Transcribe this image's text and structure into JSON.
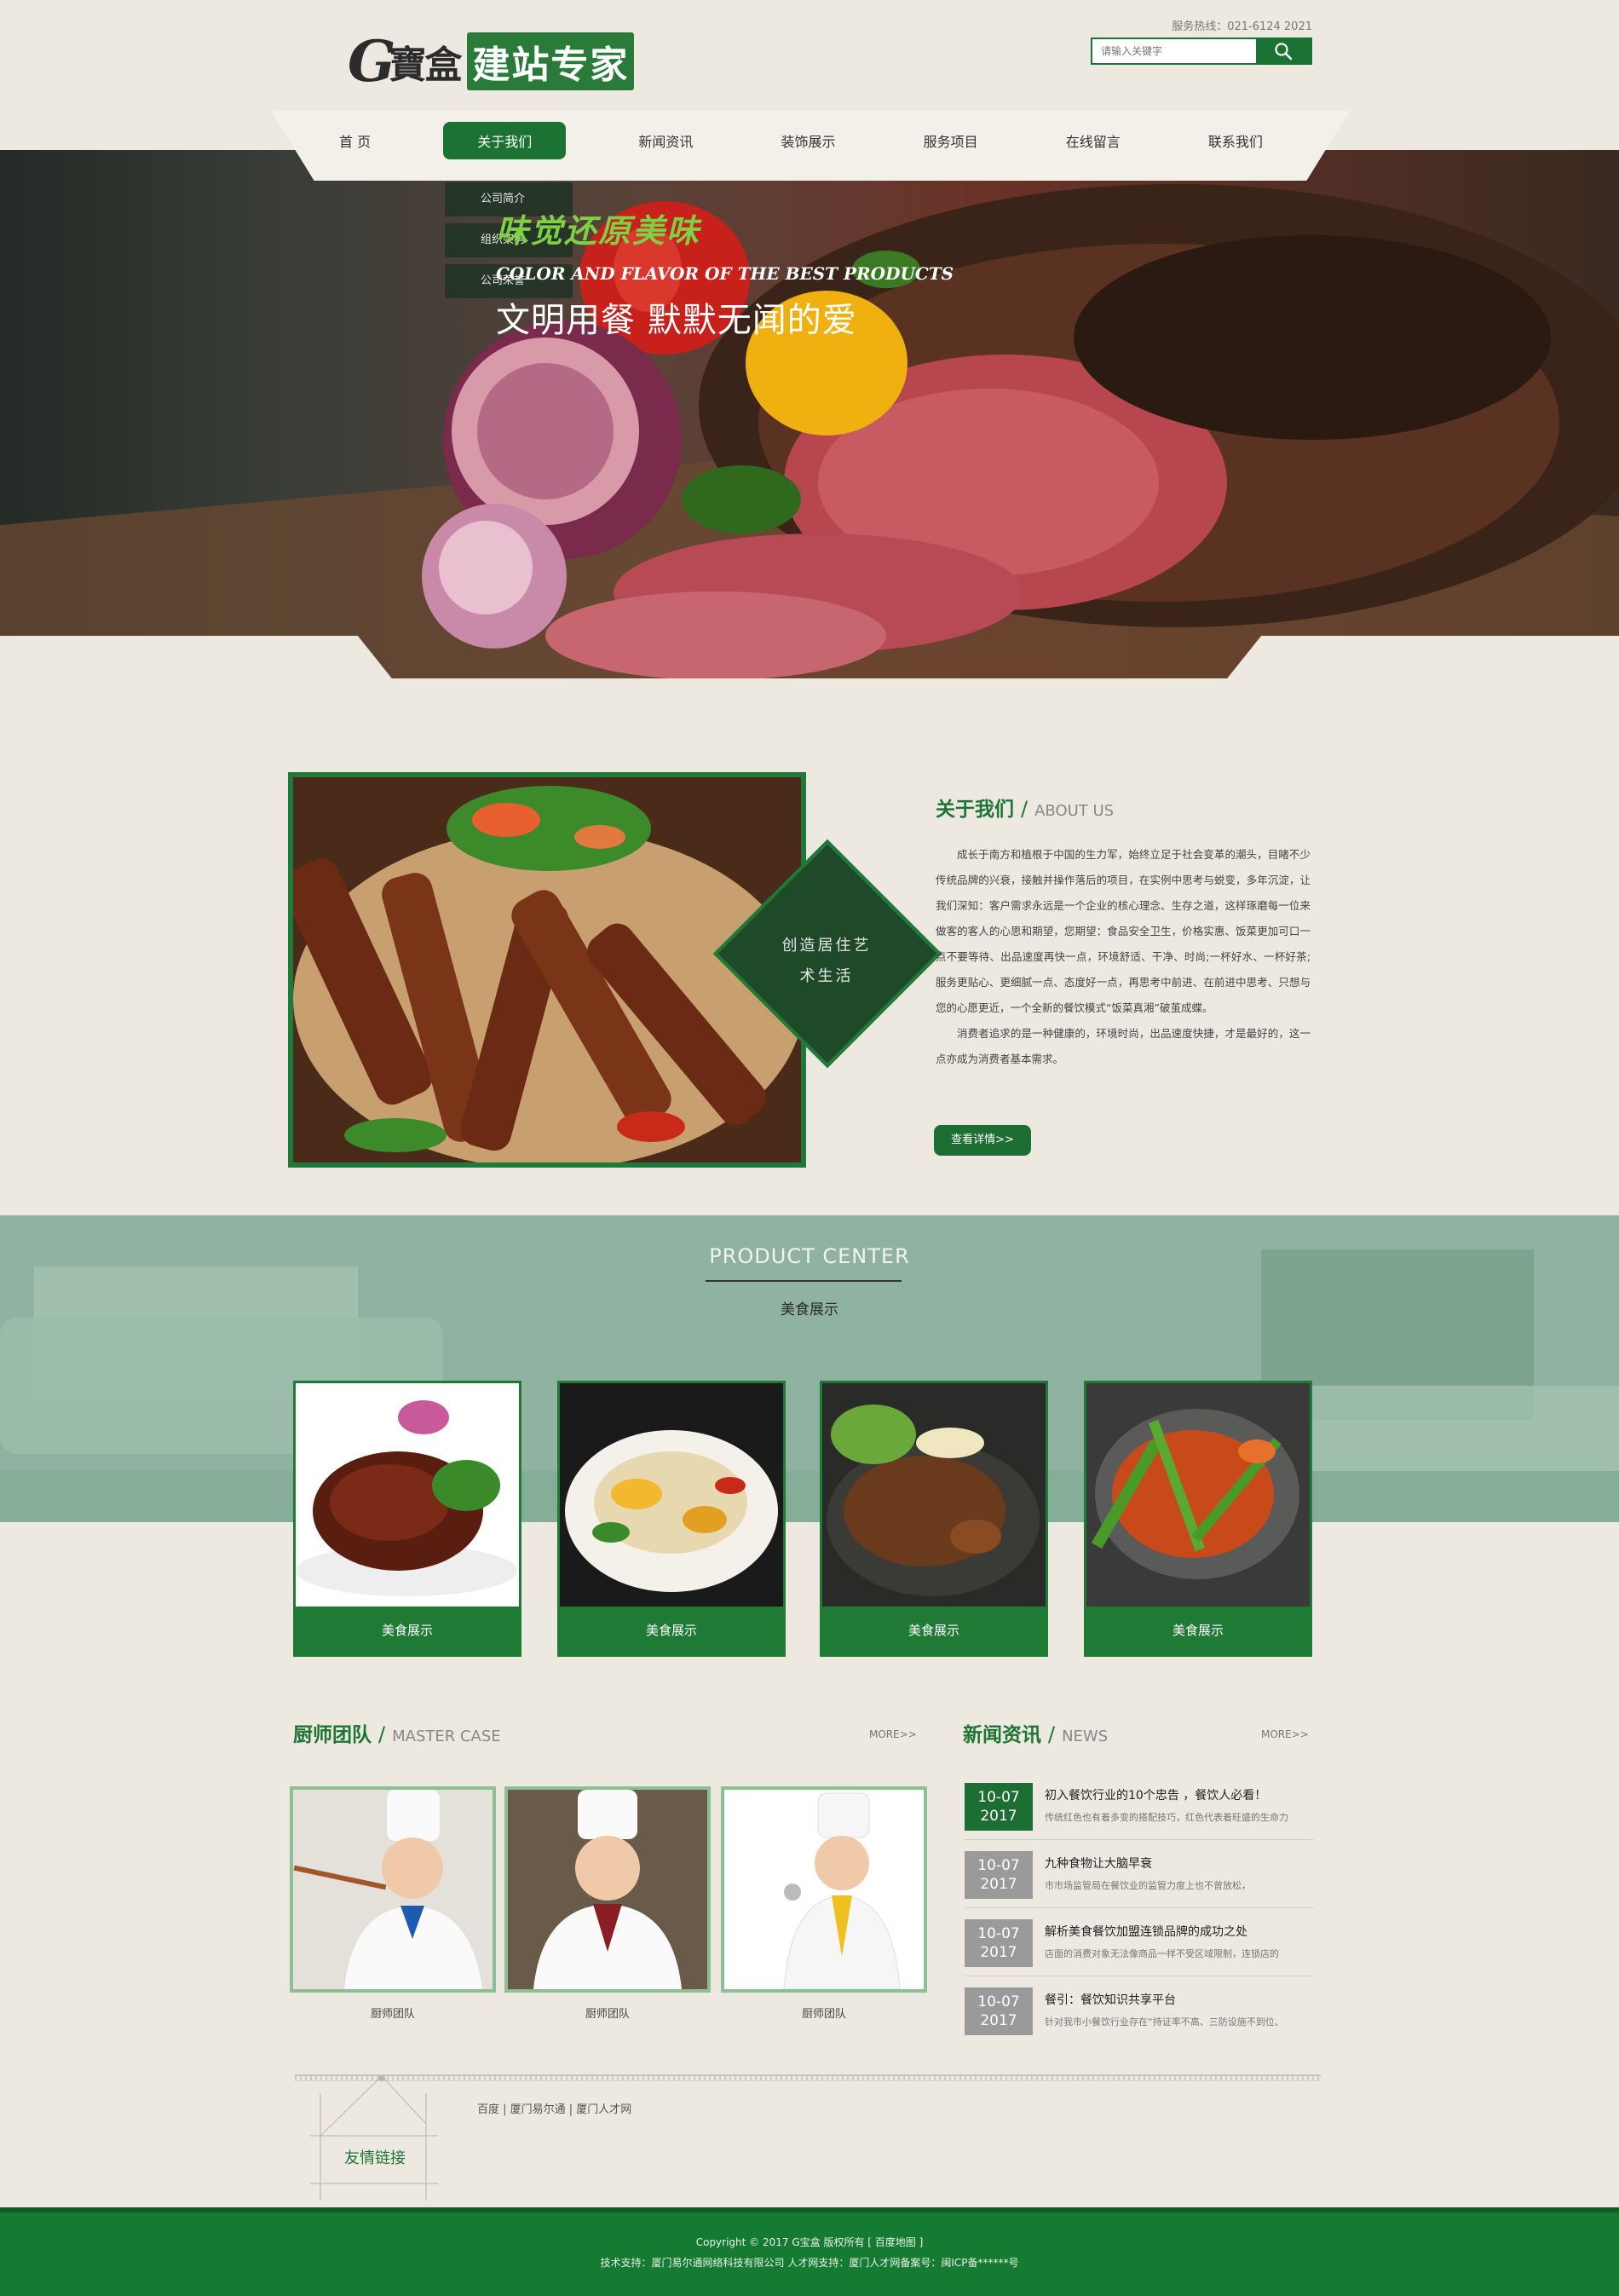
{
  "header": {
    "logo_g": "G",
    "logo_brand": "寶盒",
    "logo_tag": "建站专家",
    "hotline": "服务热线：021-6124 2021",
    "search_placeholder": "请输入关键字"
  },
  "nav": {
    "items": [
      "首 页",
      "关于我们",
      "新闻资讯",
      "装饰展示",
      "服务项目",
      "在线留言",
      "联系我们"
    ],
    "active_index": 1,
    "dropdown": [
      "公司简介",
      "组织架构",
      "公司荣誉"
    ]
  },
  "banner": {
    "line1": "味觉还原美味",
    "line2": "COLOR AND FLAVOR OF THE BEST PRODUCTS",
    "line3": "文明用餐  默默无闻的爱"
  },
  "about": {
    "diamond_line1": "创造居住艺",
    "diamond_line2": "术生活",
    "title_cn": "关于我们",
    "title_sep": "/",
    "title_en": "ABOUT US",
    "para1": "成长于南方和植根于中国的生力军，始终立足于社会变革的潮头，目睹不少传统品牌的兴衰，接触并操作落后的项目，在实例中思考与蜕变，多年沉淀，让我们深知：客户需求永远是一个企业的核心理念、生存之道，这样琢磨每一位来做客的客人的心思和期望，您期望：食品安全卫生，价格实惠、饭菜更加可口一点不要等待、出品速度再快一点，环境舒适、干净、时尚;一杯好水、一杯好茶;服务更贴心、更细腻一点、态度好一点，再思考中前进、在前进中思考、只想与您的心愿更近，一个全新的餐饮模式“饭菜真湘”破茧成蝶。",
    "para2": "消费者追求的是一种健康的，环境时尚，出品速度快捷，才是最好的，这一点亦成为消费者基本需求。",
    "more_button": "查看详情>>"
  },
  "products": {
    "title": "PRODUCT CENTER",
    "subtitle": "美食展示",
    "items": [
      "美食展示",
      "美食展示",
      "美食展示",
      "美食展示"
    ]
  },
  "chefs": {
    "title_cn": "厨师团队",
    "title_sep": "/",
    "title_en": "MASTER CASE",
    "more": "MORE>>",
    "items": [
      "厨师团队",
      "厨师团队",
      "厨师团队"
    ]
  },
  "news": {
    "title_cn": "新闻资讯",
    "title_sep": "/",
    "title_en": "NEWS",
    "more": "MORE>>",
    "items": [
      {
        "day": "10-07",
        "year": "2017",
        "title": "初入餐饮行业的10个忠告 ，餐饮人必看！",
        "desc": "传统红色也有着多变的搭配技巧，红色代表着旺盛的生命力"
      },
      {
        "day": "10-07",
        "year": "2017",
        "title": "九种食物让大脑早衰",
        "desc": "市市场监管局在餐饮业的监管力度上也不曾放松，"
      },
      {
        "day": "10-07",
        "year": "2017",
        "title": "解析美食餐饮加盟连锁品牌的成功之处",
        "desc": "店面的消费对象无法像商品一样不受区域限制，连锁店的"
      },
      {
        "day": "10-07",
        "year": "2017",
        "title": "餐引：餐饮知识共享平台",
        "desc": "针对我市小餐饮行业存在“持证率不高、三防设施不到位、"
      }
    ]
  },
  "links": {
    "label": "友情链接",
    "items": "百度 | 厦门易尔通 | 厦门人才网"
  },
  "footer": {
    "line1": "Copyright © 2017 G宝盒 版权所有 [ 百度地图 ]",
    "line2": "技术支持：厦门易尔通网络科技有限公司 人才网支持：厦门人才网备案号：闽ICP备******号"
  },
  "colors": {
    "primary_green": "#1d7533",
    "dark_green": "#1f4a2a",
    "page_bg": "#ede8e0",
    "band_green": "#8fb3a0"
  }
}
